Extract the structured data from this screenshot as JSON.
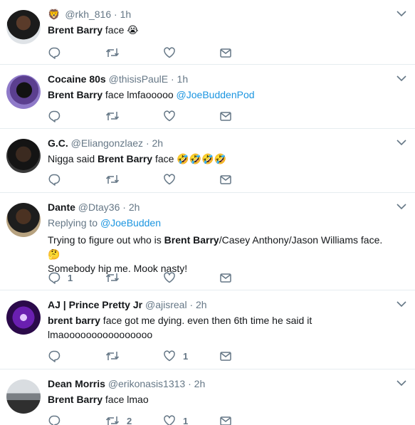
{
  "tweets": [
    {
      "badge": "🦁",
      "name": "",
      "handle": "@rkh_816",
      "dot": "·",
      "time": "1h",
      "text_parts": [
        {
          "t": "Brent Barry",
          "b": true
        },
        {
          "t": " face 😭",
          "b": false
        }
      ],
      "reply_count": "",
      "retweet_count": "",
      "like_count": ""
    },
    {
      "name": "Cocaine 80s",
      "handle": "@thisisPaulE",
      "dot": "·",
      "time": "1h",
      "text_parts": [
        {
          "t": "Brent Barry",
          "b": true
        },
        {
          "t": " face lmfaooooo ",
          "b": false
        }
      ],
      "mention": "@JoeBuddenPod",
      "reply_count": "",
      "retweet_count": "",
      "like_count": ""
    },
    {
      "name": "G.C.",
      "handle": "@Eliangonzlaez",
      "dot": "·",
      "time": "2h",
      "text_parts": [
        {
          "t": "Nigga said ",
          "b": false
        },
        {
          "t": "Brent Barry",
          "b": true
        },
        {
          "t": " face 🤣🤣🤣🤣",
          "b": false
        }
      ],
      "reply_count": "",
      "retweet_count": "",
      "like_count": ""
    },
    {
      "name": "Dante",
      "handle": "@Dtay36",
      "dot": "·",
      "time": "2h",
      "replying_label": "Replying to",
      "replying_mention": "@JoeBudden",
      "text_line1_pre": "Trying to figure out who is ",
      "text_line1_bold": "Brent Barry",
      "text_line1_post": "/Casey Anthony/Jason Williams face.🤔",
      "text_line2": "Somebody hip me. Mook nasty!",
      "reply_count": "1",
      "retweet_count": "",
      "like_count": ""
    },
    {
      "name": "AJ | Prince Pretty Jr",
      "handle": "@ajisreal",
      "dot": "·",
      "time": "2h",
      "text_line1_bold": "brent barry",
      "text_line1_post": " face got me dying. even then 6th time he said it",
      "text_line2": "lmaoooooooooooooooo",
      "reply_count": "",
      "retweet_count": "",
      "like_count": "1"
    },
    {
      "name": "Dean Morris",
      "handle": "@erikonasis1313",
      "dot": "·",
      "time": "2h",
      "text_parts": [
        {
          "t": "Brent Barry",
          "b": true
        },
        {
          "t": " face lmao",
          "b": false
        }
      ],
      "reply_count": "",
      "retweet_count": "2",
      "like_count": "1"
    }
  ],
  "icons": {
    "reply": "reply-icon",
    "retweet": "retweet-icon",
    "like": "heart-icon",
    "dm": "envelope-icon",
    "more": "chevron-down-icon"
  },
  "colors": {
    "text": "#14171a",
    "muted": "#657786",
    "link": "#1b95e0",
    "divider": "#e6ecf0"
  }
}
